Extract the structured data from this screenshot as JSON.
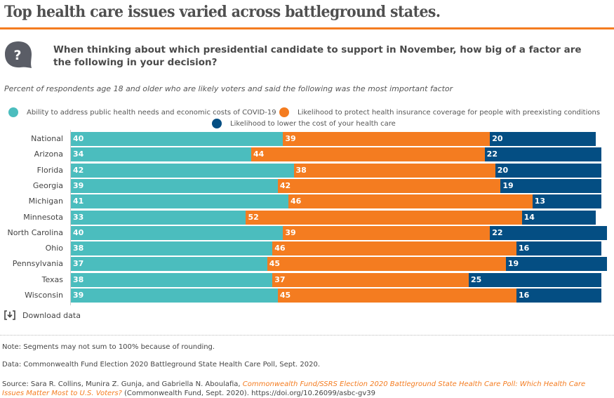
{
  "title": "Top health care issues varied across battleground states.",
  "question": "When thinking about which presidential candidate to support in November, how big of a factor are the following in your decision?",
  "subtitle": "Percent of respondents age 18 and older who are likely voters and said the following was the most important factor",
  "download_label": "Download data",
  "colors": {
    "covid": "#4bbdbe",
    "preexisting": "#f47c20",
    "cost": "#044e83",
    "accent": "#f47c20"
  },
  "footer": {
    "note": "Note: Segments may not sum to 100% because of rounding.",
    "data": "Data: Commonwealth Fund Election 2020 Battleground State Health Care Poll, Sept. 2020.",
    "source_prefix": "Source: Sara R. Collins, Munira Z. Gunja, and Gabriella N. Aboulafia, ",
    "source_title_line1": "Commonwealth Fund/SSRS Election 2020 Battleground State Health Care Poll: Which Health Care",
    "source_title_line2": "Issues Matter Most to U.S. Voters?",
    "source_suffix": " (Commonwealth Fund, Sept. 2020). ",
    "source_link": "https://doi.org/10.26099/asbc-gv39"
  },
  "chart_data": {
    "type": "bar",
    "orientation": "horizontal",
    "stacked": true,
    "title": "Top health care issues varied across battleground states.",
    "xlabel": "",
    "ylabel": "",
    "xlim": [
      0,
      100
    ],
    "grid": false,
    "legend_position": "top",
    "categories": [
      "National",
      "Arizona",
      "Florida",
      "Georgia",
      "Michigan",
      "Minnesota",
      "North Carolina",
      "Ohio",
      "Pennsylvania",
      "Texas",
      "Wisconsin"
    ],
    "series": [
      {
        "name": "Ability to address public health needs and economic costs of COVID-19",
        "key": "covid",
        "values": [
          40,
          34,
          42,
          39,
          41,
          33,
          40,
          38,
          37,
          38,
          39
        ]
      },
      {
        "name": "Likelihood to protect health insurance coverage for people with preexisting conditions",
        "key": "preexisting",
        "values": [
          39,
          44,
          38,
          42,
          46,
          52,
          39,
          46,
          45,
          37,
          45
        ]
      },
      {
        "name": "Likelihood to lower the cost of your health care",
        "key": "cost",
        "values": [
          20,
          22,
          20,
          19,
          13,
          14,
          22,
          16,
          19,
          25,
          16
        ]
      }
    ]
  }
}
